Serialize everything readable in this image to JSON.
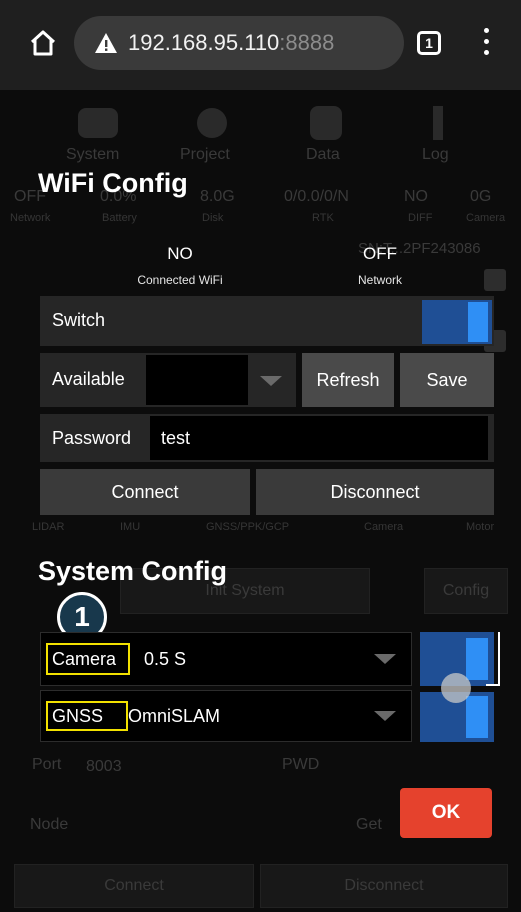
{
  "browser": {
    "url_host": "192.168.95.110",
    "url_port": ":8888",
    "tab_count": "1"
  },
  "background_app": {
    "nav_tabs": [
      "System",
      "Project",
      "Data",
      "Log"
    ],
    "status_values": [
      "OFF",
      "0.0%",
      "8.0G",
      "0/0.0/0/N",
      "NO",
      "0G"
    ],
    "status_labels": [
      "Network",
      "Battery",
      "Disk",
      "RTK",
      "DIFF",
      "Camera"
    ],
    "serial": "SN:T...2PF243086",
    "bottom_tabs": [
      "LIDAR",
      "IMU",
      "GNSS/PPK/GCP",
      "Camera",
      "Motor"
    ],
    "init_button": "Init System",
    "config_button": "Config",
    "port_label": "Port",
    "port_value": "8003",
    "pwd_label": "PWD",
    "node_label": "Node",
    "get_button": "Get",
    "connect_button": "Connect",
    "disconnect_button": "Disconnect"
  },
  "wifi_config": {
    "title": "WiFi Config",
    "connected_wifi_value": "NO",
    "connected_wifi_label": "Connected WiFi",
    "network_value": "OFF",
    "network_label": "Network",
    "switch_label": "Switch",
    "switch_state": "on",
    "available_label": "Available",
    "available_value": "",
    "refresh_button": "Refresh",
    "save_button": "Save",
    "password_label": "Password",
    "password_value": "test",
    "connect_button": "Connect",
    "disconnect_button": "Disconnect"
  },
  "system_config": {
    "title": "System Config",
    "badge_number": "1",
    "camera_label": "Camera",
    "camera_value": "0.5 S",
    "gnss_label": "GNSS",
    "gnss_value": "OmniSLAM",
    "ok_button": "OK"
  },
  "colors": {
    "toggle_on": "#2f8ff5",
    "ok_button": "#e5422d",
    "highlight": "#f2e100"
  }
}
